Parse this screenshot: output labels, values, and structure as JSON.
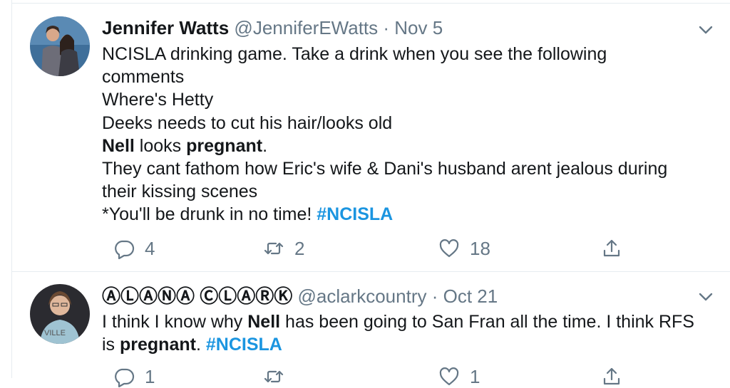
{
  "tweets": [
    {
      "name": "Jennifer Watts",
      "handle": "@JenniferEWatts",
      "separator": "·",
      "date": "Nov 5",
      "lines": {
        "l1": "NCISLA drinking game. Take a drink when you see the following",
        "l2": "comments",
        "l3": "Where's Hetty",
        "l4": "Deeks needs to cut his hair/looks old",
        "l5a": "Nell",
        "l5b": " looks ",
        "l5c": "pregnant",
        "l5d": ".",
        "l6": "They cant fathom how Eric's wife & Dani's husband arent jealous during",
        "l7": "their kissing scenes",
        "l8a": "*You'll be drunk in no time! ",
        "l8b": "#NCISLA"
      },
      "reply_count": "4",
      "retweet_count": "2",
      "like_count": "18"
    },
    {
      "name": "ⒶⓁⒶⓃⒶ ⒸⓁⒶⓇⓀ",
      "handle": "@aclarkcountry",
      "separator": "·",
      "date": "Oct 21",
      "lines": {
        "l1a": "I think I know why ",
        "l1b": "Nell",
        "l1c": " has been going to San Fran all the time. I think RFS",
        "l2a": "is ",
        "l2b": "pregnant",
        "l2c": ". ",
        "l2d": "#NCISLA"
      },
      "reply_count": "1",
      "retweet_count": "",
      "like_count": "1"
    }
  ],
  "icons": [
    "reply-icon",
    "retweet-icon",
    "like-icon",
    "share-icon",
    "chevron-down-icon"
  ],
  "colors": {
    "text": "#14171a",
    "muted": "#657786",
    "hashtag": "#1b95e0",
    "divider": "#e6ecf0"
  }
}
